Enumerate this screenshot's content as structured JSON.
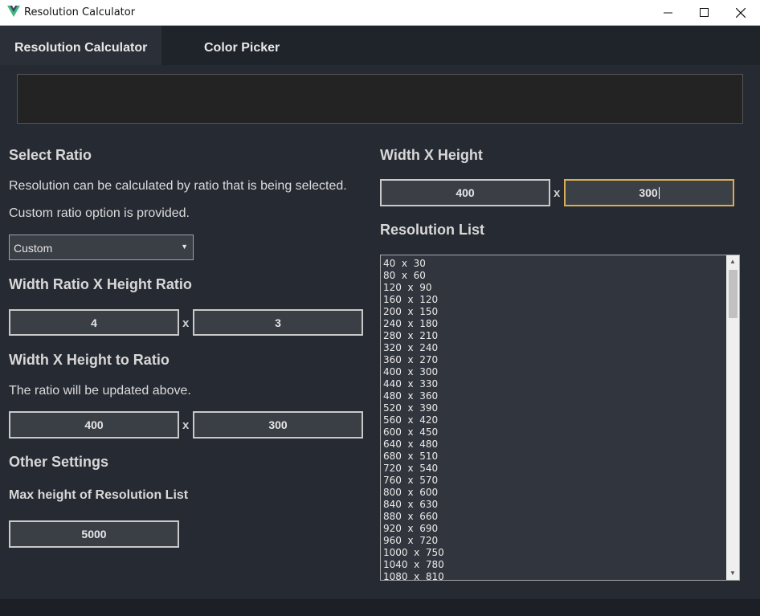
{
  "window": {
    "title": "Resolution Calculator"
  },
  "tabs": [
    {
      "label": "Resolution Calculator",
      "active": true
    },
    {
      "label": "Color Picker",
      "active": false
    }
  ],
  "select_ratio": {
    "heading": "Select Ratio",
    "line1": "Resolution can be calculated by ratio that is being selected.",
    "line2": "Custom ratio option is provided.",
    "selected": "Custom"
  },
  "ratio": {
    "heading": "Width Ratio X Height Ratio",
    "width": "4",
    "height": "3",
    "sep": "x"
  },
  "to_ratio": {
    "heading": "Width X Height to Ratio",
    "note": "The ratio will be updated above.",
    "width": "400",
    "height": "300",
    "sep": "x"
  },
  "other": {
    "heading": "Other Settings",
    "sub": "Max height of Resolution List",
    "max_height": "5000"
  },
  "wh": {
    "heading": "Width X Height",
    "width": "400",
    "height": "300",
    "sep": "x"
  },
  "resolution_list": {
    "heading": "Resolution List",
    "items": [
      "40  x  30",
      "80  x  60",
      "120  x  90",
      "160  x  120",
      "200  x  150",
      "240  x  180",
      "280  x  210",
      "320  x  240",
      "360  x  270",
      "400  x  300",
      "440  x  330",
      "480  x  360",
      "520  x  390",
      "560  x  420",
      "600  x  450",
      "640  x  480",
      "680  x  510",
      "720  x  540",
      "760  x  570",
      "800  x  600",
      "840  x  630",
      "880  x  660",
      "920  x  690",
      "960  x  720",
      "1000  x  750",
      "1040  x  780",
      "1080  x  810"
    ]
  },
  "colors": {
    "accent": "#d9ab57",
    "background": "#262a33",
    "tabbar": "#1f232a"
  }
}
